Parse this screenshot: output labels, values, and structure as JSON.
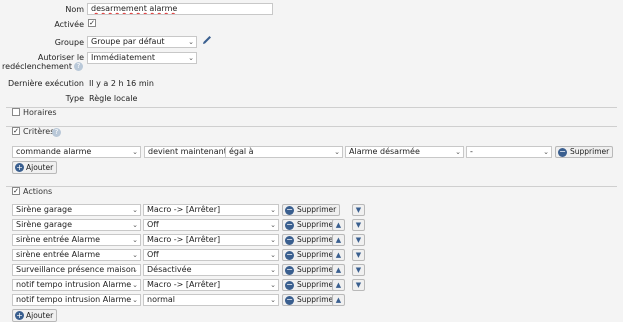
{
  "form": {
    "name_label": "Nom",
    "name_value": "desarmement alarme",
    "enabled_label": "Activée",
    "enabled_checked": true,
    "group_label": "Groupe",
    "group_value": "Groupe par défaut",
    "retrigger_label_1": "Autoriser le",
    "retrigger_label_2": "redéclenchement",
    "retrigger_value": "Immédiatement",
    "last_exec_label": "Dernière exécution",
    "last_exec_value": "Il y a 2 h 16 min",
    "type_label": "Type",
    "type_value": "Règle locale"
  },
  "sections": {
    "schedules": {
      "title": "Horaires",
      "checked": false
    },
    "criteria": {
      "title": "Critères",
      "checked": true
    },
    "actions": {
      "title": "Actions",
      "checked": true
    }
  },
  "criteria_row": {
    "subject": "commande alarme",
    "event": "devient maintenant",
    "operator": "égal à",
    "value": "Alarme désarmée",
    "extra": "-",
    "delete_label": "Supprimer"
  },
  "add_label": "Ajouter",
  "actions": [
    {
      "target": "Sirène garage",
      "command": "Macro -> [Arrêter]",
      "delete": "Supprimer",
      "up": false,
      "down": true
    },
    {
      "target": "Sirène garage",
      "command": "Off",
      "delete": "Supprimer",
      "up": true,
      "down": true
    },
    {
      "target": "sirène entrée Alarme",
      "command": "Macro -> [Arrêter]",
      "delete": "Supprimer",
      "up": true,
      "down": true
    },
    {
      "target": "sirène entrée Alarme",
      "command": "Off",
      "delete": "Supprimer",
      "up": true,
      "down": true
    },
    {
      "target": "Surveillance présence maison",
      "command": "Désactivée",
      "delete": "Supprimer",
      "up": true,
      "down": true
    },
    {
      "target": "notif tempo intrusion Alarme",
      "command": "Macro -> [Arrêter]",
      "delete": "Supprimer",
      "up": true,
      "down": true
    },
    {
      "target": "notif tempo intrusion Alarme",
      "command": "normal",
      "delete": "Supprimer",
      "up": true,
      "down": false
    }
  ],
  "icons": {
    "edit": "pencil-icon",
    "help": "question-icon",
    "delete": "minus-circle-icon",
    "add": "plus-circle-icon",
    "up": "arrow-up-icon",
    "down": "arrow-down-icon"
  },
  "colors": {
    "accent": "#3a5f8f",
    "help": "#b9c8d8"
  }
}
